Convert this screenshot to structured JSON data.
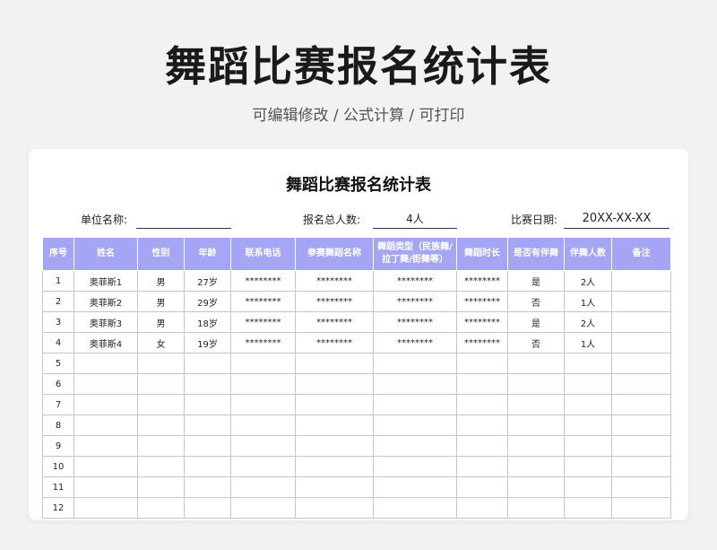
{
  "page": {
    "title": "舞蹈比赛报名统计表",
    "subtitle": "可编辑修改 /  公式计算  /  可打印"
  },
  "sheet": {
    "title": "舞蹈比赛报名统计表",
    "unit_label": "单位名称:",
    "unit_value": "",
    "total_label": "报名总人数:",
    "total_value": "4人",
    "date_label": "比赛日期:",
    "date_value": "20XX-XX-XX",
    "columns": [
      "序号",
      "姓名",
      "性别",
      "年龄",
      "联系电话",
      "参赛舞蹈名称",
      "舞蹈类型（民族舞/拉丁舞/街舞等）",
      "舞蹈时长",
      "是否有伴舞",
      "伴舞人数",
      "备注"
    ],
    "rows": [
      [
        "1",
        "奥菲斯1",
        "男",
        "27岁",
        "********",
        "********",
        "********",
        "********",
        "是",
        "2人",
        ""
      ],
      [
        "2",
        "奥菲斯2",
        "男",
        "29岁",
        "********",
        "********",
        "********",
        "********",
        "否",
        "1人",
        ""
      ],
      [
        "3",
        "奥菲斯3",
        "男",
        "18岁",
        "********",
        "********",
        "********",
        "********",
        "是",
        "2人",
        ""
      ],
      [
        "4",
        "奥菲斯4",
        "女",
        "19岁",
        "********",
        "********",
        "********",
        "********",
        "否",
        "1人",
        ""
      ],
      [
        "5",
        "",
        "",
        "",
        "",
        "",
        "",
        "",
        "",
        "",
        ""
      ],
      [
        "6",
        "",
        "",
        "",
        "",
        "",
        "",
        "",
        "",
        "",
        ""
      ],
      [
        "7",
        "",
        "",
        "",
        "",
        "",
        "",
        "",
        "",
        "",
        ""
      ],
      [
        "8",
        "",
        "",
        "",
        "",
        "",
        "",
        "",
        "",
        "",
        ""
      ],
      [
        "9",
        "",
        "",
        "",
        "",
        "",
        "",
        "",
        "",
        "",
        ""
      ],
      [
        "10",
        "",
        "",
        "",
        "",
        "",
        "",
        "",
        "",
        "",
        ""
      ],
      [
        "11",
        "",
        "",
        "",
        "",
        "",
        "",
        "",
        "",
        "",
        ""
      ],
      [
        "12",
        "",
        "",
        "",
        "",
        "",
        "",
        "",
        "",
        "",
        ""
      ]
    ]
  }
}
